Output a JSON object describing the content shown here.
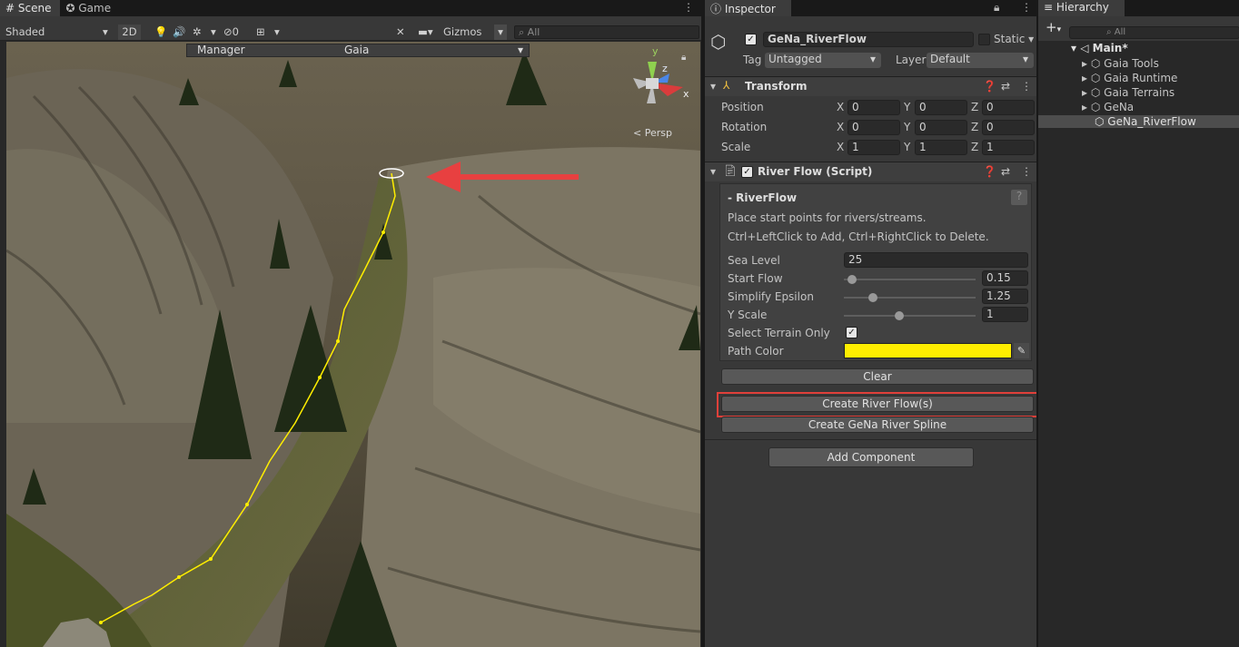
{
  "scene_panel": {
    "tabs": [
      "Scene",
      "Game"
    ],
    "tab_icons": [
      "grid-icon",
      "gamepad-icon"
    ],
    "toolbar": {
      "shading_mode": "Shaded",
      "mode_2d": "2D",
      "hidden_count": "0",
      "gizmos_label": "Gizmos",
      "search_placeholder": "All"
    },
    "overlay": {
      "manager_label": "Manager",
      "gaia_label": "Gaia"
    },
    "gizmo": {
      "y_label": "y",
      "z_label": "z",
      "x_label": "x",
      "projection_label": "Persp"
    },
    "path_color": "#ffee00",
    "arrow_color": "#e84040"
  },
  "inspector": {
    "tab_label": "Inspector",
    "object": {
      "active_checked": true,
      "name": "GeNa_RiverFlow",
      "static_label": "Static",
      "tag_label": "Tag",
      "tag_value": "Untagged",
      "layer_label": "Layer",
      "layer_value": "Default"
    },
    "transform": {
      "title": "Transform",
      "rows": [
        {
          "label": "Position",
          "x": "0",
          "y": "0",
          "z": "0"
        },
        {
          "label": "Rotation",
          "x": "0",
          "y": "0",
          "z": "0"
        },
        {
          "label": "Scale",
          "x": "1",
          "y": "1",
          "z": "1"
        }
      ],
      "axis_labels": [
        "X",
        "Y",
        "Z"
      ]
    },
    "river_flow": {
      "title": "River Flow (Script)",
      "enabled": true,
      "section_title": "- RiverFlow",
      "help_label": "?",
      "description_1": "Place start points for rivers/streams.",
      "description_2": "Ctrl+LeftClick to Add, Ctrl+RightClick to Delete.",
      "sea_level_label": "Sea Level",
      "sea_level_value": "25",
      "sliders": [
        {
          "label": "Start Flow",
          "value": "0.15",
          "fraction": 0.06
        },
        {
          "label": "Simplify Epsilon",
          "value": "1.25",
          "fraction": 0.22
        },
        {
          "label": "Y Scale",
          "value": "1",
          "fraction": 0.42
        }
      ],
      "select_terrain_label": "Select Terrain Only",
      "select_terrain_checked": true,
      "path_color_label": "Path Color",
      "path_color_value": "#ffee00",
      "clear_button": "Clear",
      "create_flow_button": "Create River Flow(s)",
      "create_spline_button": "Create GeNa River Spline"
    },
    "add_component_button": "Add Component",
    "highlight_color": "#e0403a"
  },
  "hierarchy": {
    "tab_label": "Hierarchy",
    "add_label": "+",
    "search_placeholder": "All",
    "scene_name": "Main*",
    "items": [
      {
        "label": "Gaia Tools",
        "expandable": true
      },
      {
        "label": "Gaia Runtime",
        "expandable": true
      },
      {
        "label": "Gaia Terrains",
        "expandable": true
      },
      {
        "label": "GeNa",
        "expandable": true
      },
      {
        "label": "GeNa_RiverFlow",
        "expandable": false,
        "selected": true
      }
    ]
  }
}
